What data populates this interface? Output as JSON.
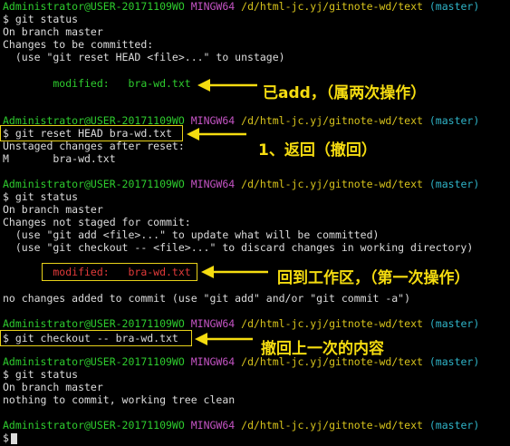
{
  "prompt": {
    "user": "Administrator@USER-20171109WO",
    "env": "MINGW64",
    "path": "/d/html-jc.yj/gitnote-wd/text",
    "branch": "(master)"
  },
  "blocks": [
    {
      "command": "$ git status",
      "output": [
        "On branch master",
        "Changes to be committed:",
        "  (use \"git reset HEAD <file>...\" to unstage)",
        "",
        "        modified:   bra-wd.txt"
      ]
    },
    {
      "command": "$ git reset HEAD bra-wd.txt",
      "output": [
        "Unstaged changes after reset:",
        "M       bra-wd.txt"
      ]
    },
    {
      "command": "$ git status",
      "output": [
        "On branch master",
        "Changes not staged for commit:",
        "  (use \"git add <file>...\" to update what will be committed)",
        "  (use \"git checkout -- <file>...\" to discard changes in working directory)",
        "",
        "        modified:   bra-wd.txt",
        "",
        "no changes added to commit (use \"git add\" and/or \"git commit -a\")"
      ]
    },
    {
      "command": "$ git checkout -- bra-wd.txt",
      "output": []
    },
    {
      "command": "$ git status",
      "output": [
        "On branch master",
        "nothing to commit, working tree clean"
      ]
    }
  ],
  "final_prompt": "$",
  "annotations": {
    "a1": "已add，（属两次操作）",
    "a2": "1、返回（撤回）",
    "a3": "回到工作区，（第一次操作）",
    "a4": "撤回上一次的内容"
  },
  "colors": {
    "user": "#2ecc2e",
    "env": "#c454c4",
    "path": "#d7c31c",
    "branch": "#2fb4c8",
    "staged": "#2ecc2e",
    "unstaged": "#e23a3a",
    "annotation": "#f5dc10"
  }
}
